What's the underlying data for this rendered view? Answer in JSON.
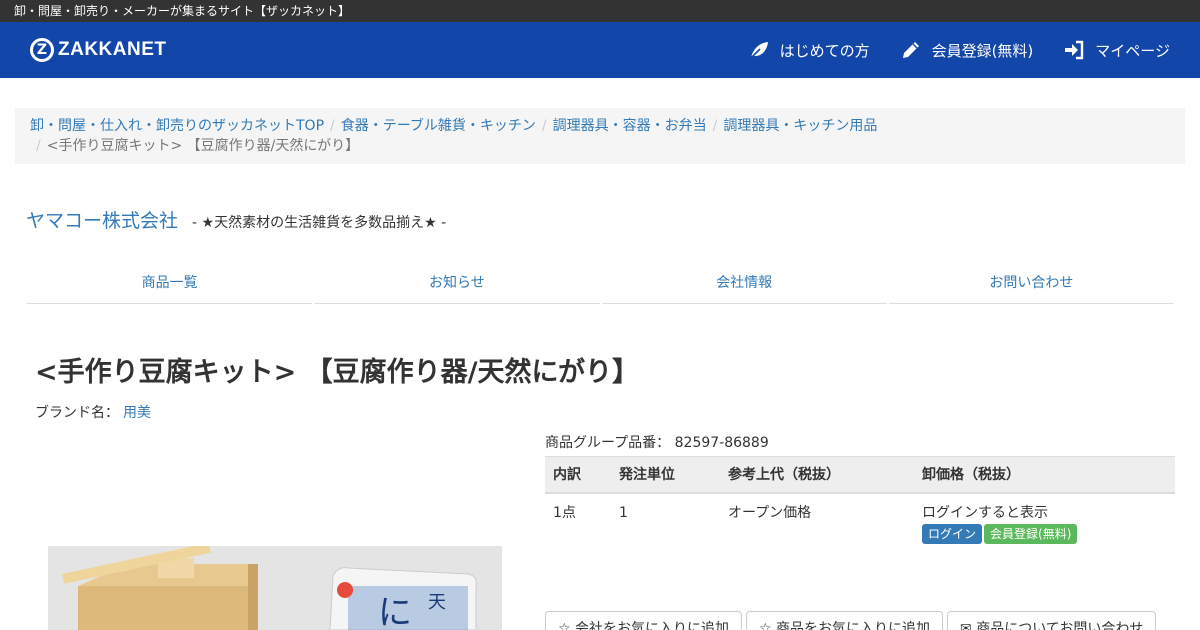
{
  "topbar": {
    "text": "卸・問屋・卸売り・メーカーが集まるサイト【ザッカネット】"
  },
  "header": {
    "logo_mark": "Z",
    "logo_text": "ZAKKANET",
    "nav": [
      {
        "label": "はじめての方",
        "icon": "leaf-icon"
      },
      {
        "label": "会員登録(無料)",
        "icon": "pencil-icon"
      },
      {
        "label": "マイページ",
        "icon": "sign-in-icon"
      }
    ]
  },
  "breadcrumb": {
    "items": [
      "卸・問屋・仕入れ・卸売りのザッカネットTOP",
      "食器・テーブル雑貨・キッチン",
      "調理器具・容器・お弁当",
      "調理器具・キッチン用品"
    ],
    "separator": "/",
    "current": "<手作り豆腐キット> 【豆腐作り器/天然にがり】"
  },
  "company": {
    "name": "ヤマコー株式会社",
    "tagline": "- ★天然素材の生活雑貨を多数品揃え★ -"
  },
  "tabs": [
    "商品一覧",
    "お知らせ",
    "会社情報",
    "お問い合わせ"
  ],
  "product": {
    "title": "<手作り豆腐キット> 【豆腐作り器/天然にがり】",
    "brand_label": "ブランド名：",
    "brand_value": "用美",
    "group_label": "商品グループ品番：",
    "group_value": "82597-86889"
  },
  "price_table": {
    "headers": [
      "内訳",
      "発注単位",
      "参考上代（税抜）",
      "卸価格（税抜）"
    ],
    "rows": [
      {
        "content": "1点",
        "unit": "1",
        "retail": "オープン価格",
        "wholesale": "ログインすると表示"
      }
    ],
    "login_button": "ログイン",
    "register_button": "会員登録(無料)"
  },
  "actions": [
    "☆ 会社をお気に入りに追加",
    "☆ 商品をお気に入りに追加",
    "✉ 商品についてお問い合わせ"
  ],
  "colors": {
    "header_bg": "#1246a8",
    "link": "#337ab7",
    "topbar_bg": "#333333",
    "btn_login": "#337ab7",
    "btn_register": "#5cb85c"
  }
}
